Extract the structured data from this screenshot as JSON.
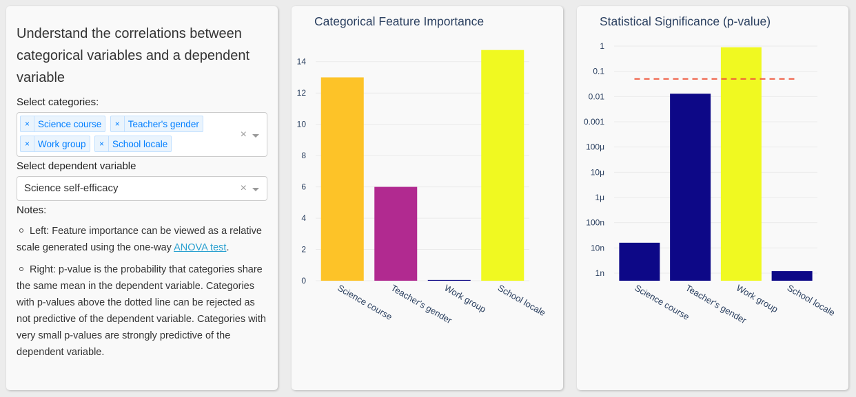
{
  "panel": {
    "heading": "Understand the correlations between categorical variables and a dependent variable",
    "categories_label": "Select categories:",
    "categories_selected": [
      "Science course",
      "Teacher's gender",
      "Work group",
      "School locale"
    ],
    "dependent_label": "Select dependent variable",
    "dependent_value": "Science self-efficacy",
    "clear_glyph": "×",
    "notes_label": "Notes:",
    "note1_text": "Left: Feature importance can be viewed as a relative scale generated using the one-way",
    "note1_link": "ANOVA test",
    "note1_end": ".",
    "note2_text": "Right: p-value is the probability that categories share the same mean in the dependent variable. Categories with p-values above the dotted line can be rejected as not predictive of the dependent variable. Categories with very small p-values are strongly predictive of the dependent variable."
  },
  "chart_data": [
    {
      "type": "bar",
      "title": "Categorical Feature Importance",
      "categories": [
        "Science course",
        "Teacher's gender",
        "Work group",
        "School locale"
      ],
      "values": [
        13.0,
        6.0,
        0.05,
        14.75
      ],
      "colors": [
        "#fdc328",
        "#b12a90",
        "#0d0887",
        "#f0f921"
      ],
      "ylim": [
        0,
        15
      ],
      "yticks": [
        0,
        2,
        4,
        6,
        8,
        10,
        12,
        14
      ],
      "ytick_labels": [
        "0",
        "2",
        "4",
        "6",
        "8",
        "10",
        "12",
        "14"
      ],
      "grid": true
    },
    {
      "type": "bar",
      "title": "Statistical Significance (p-value)",
      "categories": [
        "Science course",
        "Teacher's gender",
        "Work group",
        "School locale"
      ],
      "values": [
        1.6e-08,
        0.013,
        0.9,
        1.2e-09
      ],
      "colors": [
        "#0d0887",
        "#0d0887",
        "#f0f921",
        "#0d0887"
      ],
      "yscale": "log",
      "ylim": [
        5e-10,
        1
      ],
      "yticks": [
        1e-09,
        1e-08,
        1e-07,
        1e-06,
        1e-05,
        0.0001,
        0.001,
        0.01,
        0.1,
        1
      ],
      "ytick_labels": [
        "1n",
        "10n",
        "100n",
        "1μ",
        "10μ",
        "100μ",
        "0.001",
        "0.01",
        "0.1",
        "1"
      ],
      "threshold": 0.05,
      "threshold_color": "#ef553b",
      "grid": true
    }
  ]
}
